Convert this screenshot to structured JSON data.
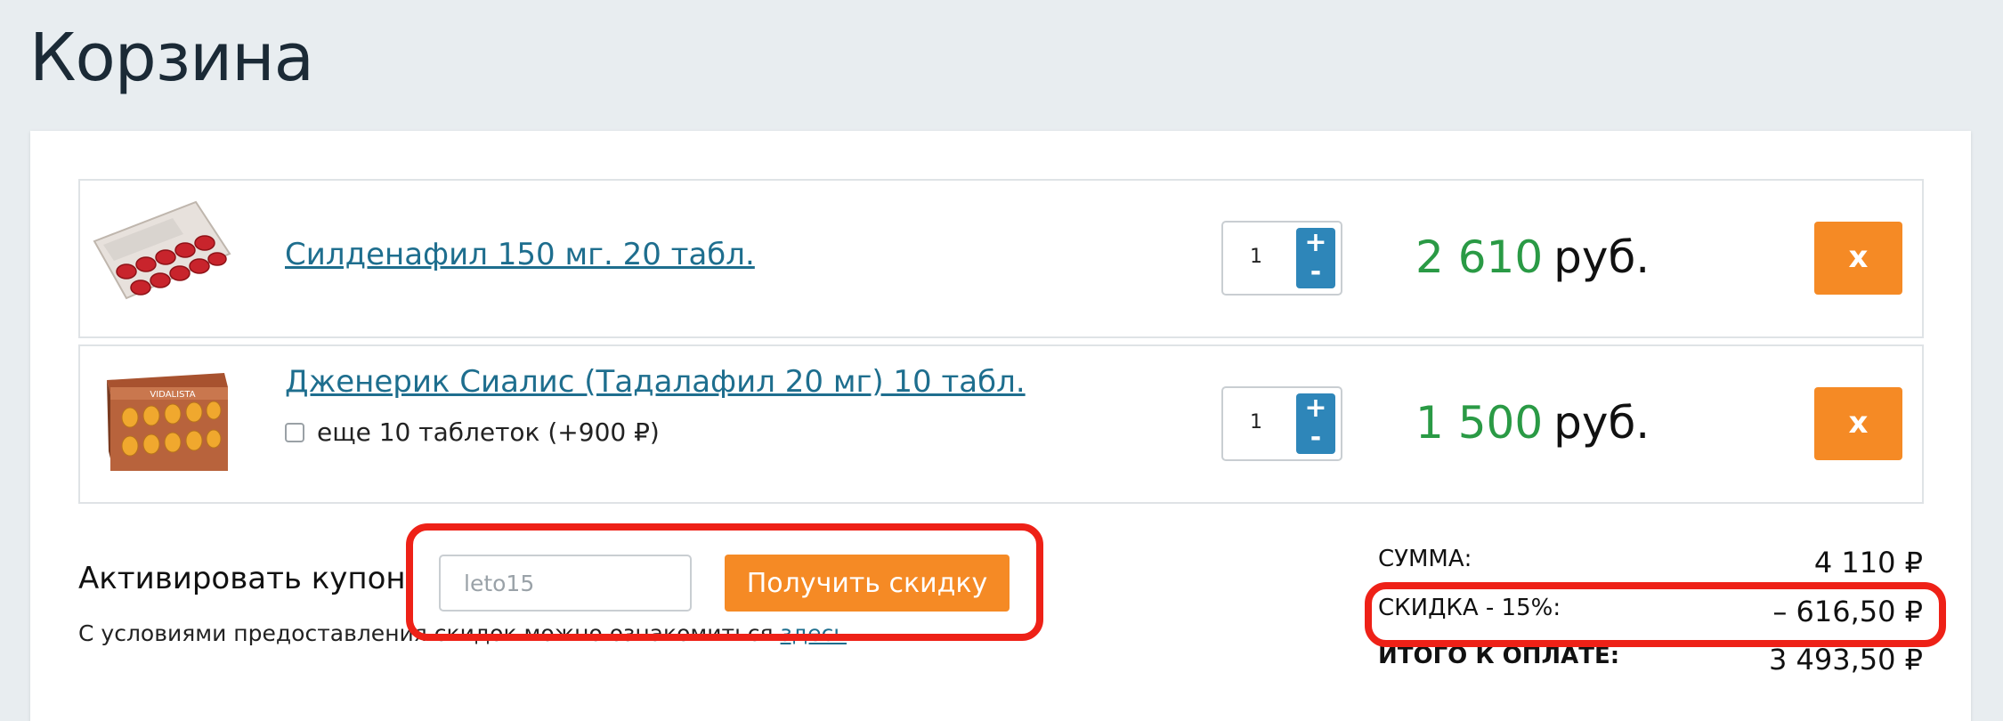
{
  "page": {
    "title": "Корзина"
  },
  "cart": {
    "items": [
      {
        "name": "Силденафил 150 мг. 20 табл.",
        "quantity": "1",
        "price": "2 610",
        "currency": "руб.",
        "remove_label": "x",
        "thumbnail_icon": "red-pill-blister-icon"
      },
      {
        "name": "Дженерик Сиалис (Тадалафил 20 мг) 10 табл.",
        "extra_option": "еще 10 таблеток (+900 ₽)",
        "quantity": "1",
        "price": "1 500",
        "currency": "руб.",
        "remove_label": "x",
        "thumbnail_icon": "orange-pill-box-icon"
      }
    ],
    "qty_plus": "+",
    "qty_minus": "-"
  },
  "coupon": {
    "label": "Активировать купон",
    "value": "leto15",
    "button_label": "Получить скидку",
    "note_text": "С условиями предоставления скидок можно ознакомиться ",
    "note_link": "здесь",
    "note_end": "."
  },
  "summary": {
    "sum_label": "СУММА:",
    "sum_value": "4 110 ₽",
    "discount_label": "СКИДКА - 15%:",
    "discount_value": "– 616,50 ₽",
    "total_label": "ИТОГО К ОПЛАТЕ:",
    "total_value": "3 493,50 ₽"
  },
  "colors": {
    "accent_orange": "#f58a25",
    "price_green": "#2a9a45",
    "link_blue": "#1e6e8e",
    "qty_blue": "#2e86b9",
    "highlight_red": "#ee2117"
  }
}
